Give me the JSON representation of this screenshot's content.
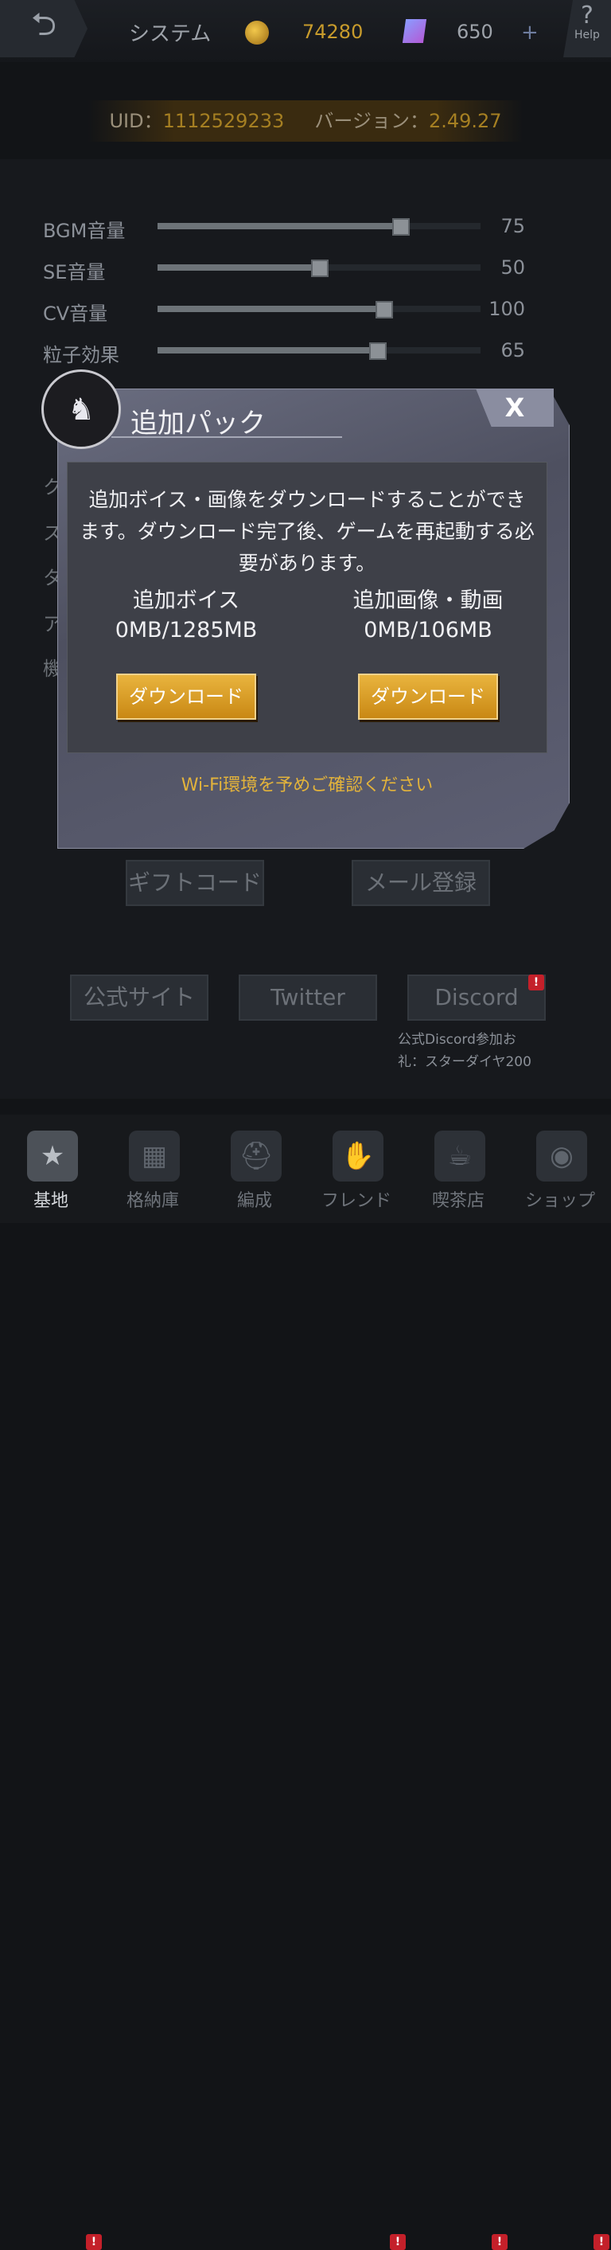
{
  "header": {
    "back_icon": "back-arrow-icon",
    "title": "システム",
    "coins": "74280",
    "gems": "650",
    "plus": "+",
    "help_q": "?",
    "help_label": "Help"
  },
  "info": {
    "uid_label": "UID：",
    "uid": "1112529233",
    "version_label": "バージョン：",
    "version": "2.49.27"
  },
  "settings": [
    {
      "label": "BGM音量",
      "value": "75",
      "level": 0.75
    },
    {
      "label": "SE音量",
      "value": "50",
      "level": 0.5
    },
    {
      "label": "CV音量",
      "value": "100",
      "level": 0.7
    },
    {
      "label": "粒子効果",
      "value": "65",
      "level": 0.68
    }
  ],
  "side_chars": [
    "ク",
    "ス",
    "タ",
    "ア",
    "機"
  ],
  "buttons": {
    "gift": "ギフトコード",
    "mail": "メール登録",
    "official": "公式サイト",
    "twitter": "Twitter",
    "discord": "Discord",
    "badge": "!"
  },
  "discord_note": {
    "line1": "公式Discord参加お",
    "line2": "礼：スターダイヤ200"
  },
  "modal": {
    "title": "追加パック",
    "close": "X",
    "description": "追加ボイス・画像をダウンロードすることができます。ダウンロード完了後、ゲームを再起動する必要があります。",
    "voice_title": "追加ボイス",
    "voice_size": "0MB/1285MB",
    "image_title": "追加画像・動画",
    "image_size": "0MB/106MB",
    "download": "ダウンロード",
    "wifi_note": "Wi-Fi環境を予めご確認ください"
  },
  "nav": [
    {
      "label": "基地",
      "icon": "star-shield-icon"
    },
    {
      "label": "格納庫",
      "icon": "hangar-icon"
    },
    {
      "label": "編成",
      "icon": "helmet-icon"
    },
    {
      "label": "フレンド",
      "icon": "handshake-icon"
    },
    {
      "label": "喫茶店",
      "icon": "cafe-icon"
    },
    {
      "label": "ショップ",
      "icon": "shop-icon"
    }
  ],
  "colors": {
    "accent_gold": "#e3b33b",
    "badge_red": "#c4202a",
    "modal_bg": "#4e5060"
  }
}
